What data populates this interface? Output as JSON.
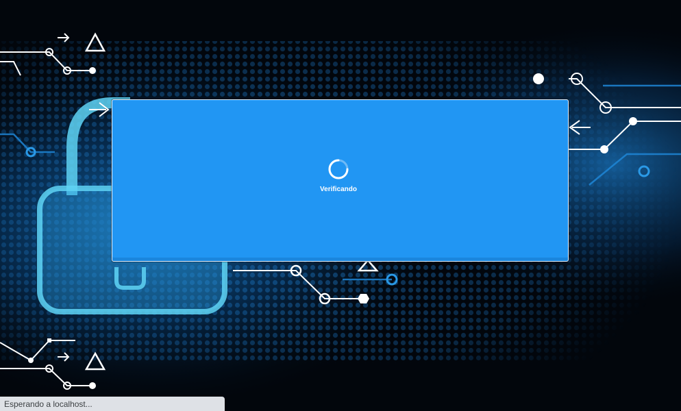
{
  "page": {
    "background_theme": "cyber-security-padlock-circuit"
  },
  "modal": {
    "background_color": "#2196f3",
    "loader_text": "Verificando",
    "spinner_icon": "spinner-icon"
  },
  "statusbar": {
    "text": "Esperando a localhost..."
  },
  "colors": {
    "accent": "#2196f3",
    "background": "#02060c",
    "glow": "#1e8fe0"
  }
}
